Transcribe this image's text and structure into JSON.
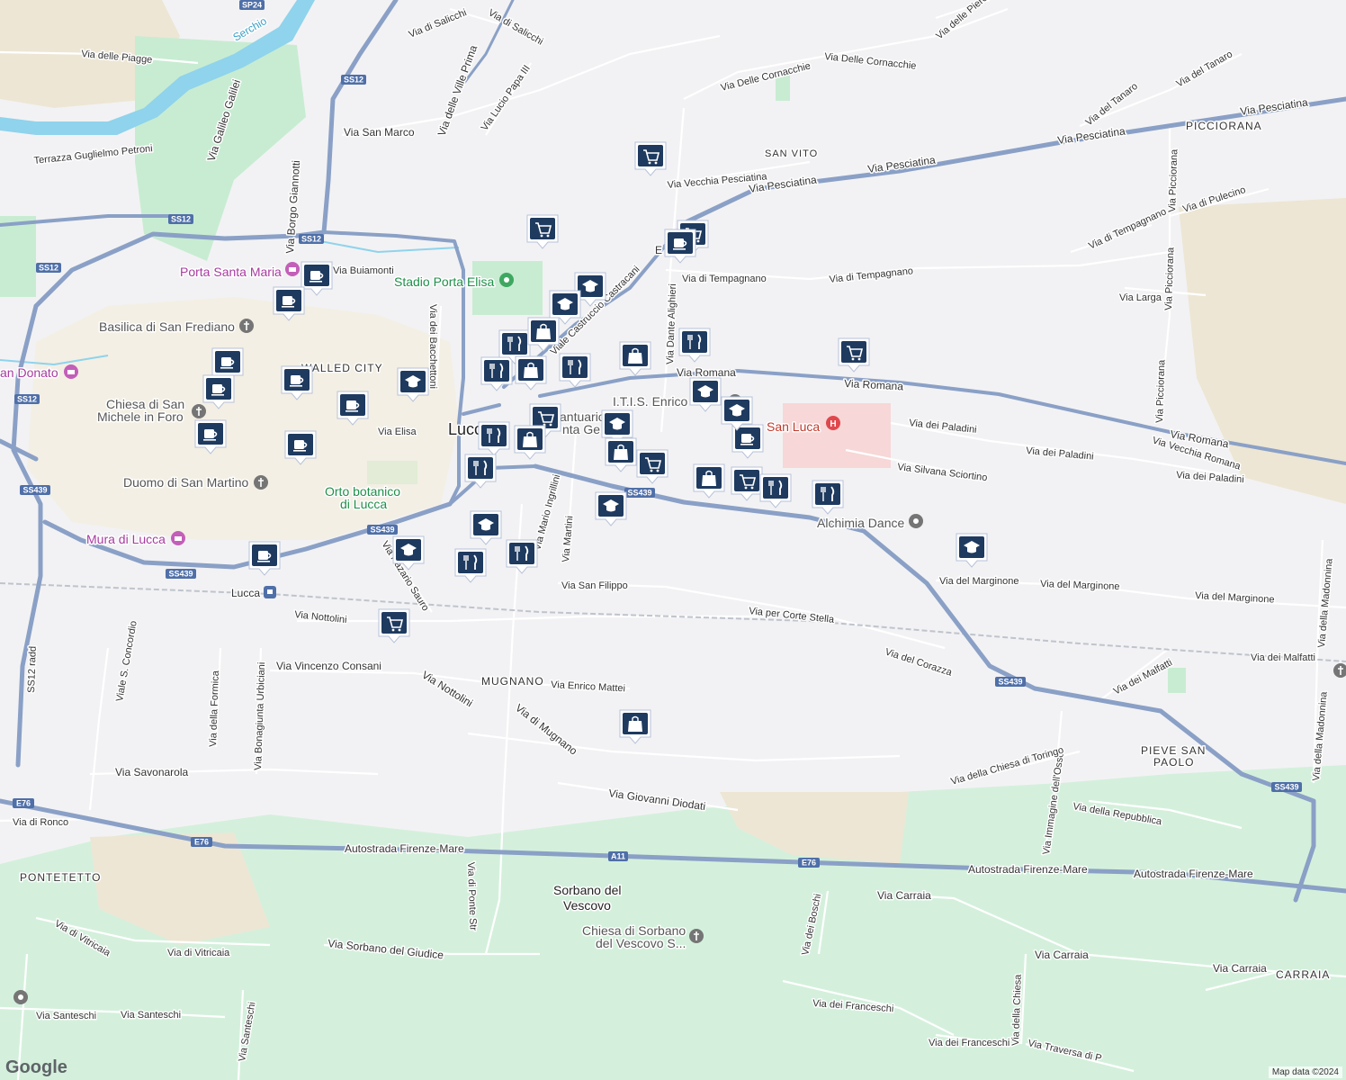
{
  "map": {
    "attribution": "Map data ©2024",
    "logo_text": "Google",
    "colors": {
      "background": "#f2f2f4",
      "park": "#c8ecd2",
      "road_major": "#8aa0c6",
      "road_minor": "#ffffff",
      "water": "#8fd3ec",
      "marker": "#1e3a5f"
    },
    "labels": {
      "lucca": "Lucca",
      "lucca_station": "Lucca",
      "walled_city": "WALLED CITY",
      "san_vito": "SAN VITO",
      "picciorana": "PICCIORANA",
      "mugnano": "MUGNANO",
      "pieve_san_paolo_1": "PIEVE SAN",
      "pieve_san_paolo_2": "PAOLO",
      "pontetetto": "PONTETETTO",
      "sorbano_1": "Sorbano del",
      "sorbano_2": "Vescovo",
      "carraia": "CARRAIA",
      "serchio": "Serchio",
      "porta_santa_maria": "Porta Santa Maria",
      "stadio": "Stadio Porta Elisa",
      "basilica": "Basilica di San Frediano",
      "san_donato": "an Donato",
      "chiesa_michele_1": "Chiesa di San",
      "chiesa_michele_2": "Michele in Foro",
      "duomo": "Duomo di San Martino",
      "orto_1": "Orto botanico",
      "orto_2": "di Lucca",
      "mura": "Mura di Lucca",
      "itis": "I.T.I.S. Enrico",
      "santuario_1": "antuario",
      "santuario_2": "nta Ge",
      "ospedale": "O",
      "ospedale_2": "San Luca",
      "alchimia": "Alchimia Dance",
      "chiesa_sorbano_1": "Chiesa di Sorbano",
      "chiesa_sorbano_2": "del Vescovo S...",
      "e_label": "E"
    },
    "roads": {
      "via_pesciatina": "Via Pesciatina",
      "via_romana": "Via Romana",
      "via_di_tempagnano": "Via di Tempagnano",
      "via_delle_cornacchie": "Via Delle Cornacchie",
      "via_vecchia_pesciatina": "Via Vecchia Pesciatina",
      "via_san_marco": "Via San Marco",
      "via_elisa": "Via Elisa",
      "via_buiamonti": "Via Buiamonti",
      "via_dei_bacchettoni": "Via dei Bacchettoni",
      "via_dei_paladini": "Via dei Paladini",
      "via_silvana_sciortino": "Via Silvana Sciortino",
      "via_del_marginone": "Via del Marginone",
      "via_san_filippo": "Via San Filippo",
      "via_per_corte_stella": "Via per Corte Stella",
      "via_del_corazza": "Via del Corazza",
      "via_dei_malfatti": "Via dei Malfatti",
      "via_nottolini": "Via Nottolini",
      "via_vincenzo_consani": "Via Vincenzo Consani",
      "via_enrico_mattei": "Via Enrico Mattei",
      "via_di_mugnano": "Via di Mugnano",
      "via_giovanni_diodati": "Via Giovanni Diodati",
      "via_savonarola": "Via Savonarola",
      "via_di_ronco": "Via di Ronco",
      "autostrada": "Autostrada Firenze-Mare",
      "via_carraia": "Via Carraia",
      "via_sorbano_giudice": "Via Sorbano del Giudice",
      "via_di_vitricaia": "Via di Vitricaia",
      "via_santeschi": "Via Santeschi",
      "via_dei_franceschi": "Via dei Franceschi",
      "via_di_ponte_str": "Via di Ponte Str",
      "via_dei_boschi": "Via dei Boschi",
      "via_della_chiesa": "Via della Chiesa",
      "via_della_repubblica": "Via della Repubblica",
      "via_immagine_osso": "Via Immagine dell'Osso",
      "via_chiesa_toringo": "Via della Chiesa di Toringo",
      "via_della_madonnina": "Via della Madonnina",
      "via_picciorana": "Via Picciorana",
      "via_larga": "Via Larga",
      "via_di_pulecino": "Via di Pulecino",
      "via_del_tanaro": "Via del Tanaro",
      "via_delle_piagge": "Via delle Piagge",
      "terrazza_petroni": "Terrazza Guglielmo Petroni",
      "via_galileo_galilei": "Via Galileo Galilei",
      "via_borgo_giannotti": "Via Borgo Giannotti",
      "via_delle_ville_prima": "Via delle Ville Prima",
      "via_lucio_papa": "Via Lucio Papa III",
      "via_di_salicchi": "Via di Salicchi",
      "via_castracani": "Viale Castruccio Castracani",
      "via_dante_alighieri": "Via Dante Alighieri",
      "via_della_formica": "Via della Formica",
      "via_bonagiunta": "Via Bonagiunta Urbiciani",
      "viale_concordio": "Viale S. Concordio",
      "via_martini": "Via Martini",
      "via_nazario_sauro": "Via Nazario Sauro",
      "via_ingrillini": "Via Mario Ingrillini",
      "via_della_formica_2": "Via della Formica",
      "via_santeschi_2": "Via Santeschi",
      "via_traversa": "Via Traversa di P",
      "via_delle_piero": "Via delle Piero"
    },
    "shields": [
      "SP24",
      "SS12",
      "SS12",
      "SS12",
      "SS12",
      "SS12",
      "SS439",
      "SS439",
      "SS439",
      "SS439",
      "SS439",
      "SS439",
      "E76",
      "E76",
      "E76",
      "A11"
    ],
    "markers": [
      {
        "icon": "cart-icon"
      },
      {
        "icon": "cart-icon"
      },
      {
        "icon": "cart-icon"
      },
      {
        "icon": "cart-icon"
      },
      {
        "icon": "cart-icon"
      },
      {
        "icon": "cart-icon"
      },
      {
        "icon": "cart-icon"
      },
      {
        "icon": "cart-icon"
      },
      {
        "icon": "cup-icon"
      },
      {
        "icon": "cup-icon"
      },
      {
        "icon": "cup-icon"
      },
      {
        "icon": "cup-icon"
      },
      {
        "icon": "cup-icon"
      },
      {
        "icon": "cup-icon"
      },
      {
        "icon": "cup-icon"
      },
      {
        "icon": "cup-icon"
      },
      {
        "icon": "cup-icon"
      },
      {
        "icon": "cup-icon"
      },
      {
        "icon": "cup-icon"
      },
      {
        "icon": "school-icon"
      },
      {
        "icon": "school-icon"
      },
      {
        "icon": "school-icon"
      },
      {
        "icon": "school-icon"
      },
      {
        "icon": "school-icon"
      },
      {
        "icon": "school-icon"
      },
      {
        "icon": "school-icon"
      },
      {
        "icon": "school-icon"
      },
      {
        "icon": "school-icon"
      },
      {
        "icon": "school-icon"
      },
      {
        "icon": "fork-knife-icon"
      },
      {
        "icon": "fork-knife-icon"
      },
      {
        "icon": "fork-knife-icon"
      },
      {
        "icon": "fork-knife-icon"
      },
      {
        "icon": "fork-knife-icon"
      },
      {
        "icon": "fork-knife-icon"
      },
      {
        "icon": "fork-knife-icon"
      },
      {
        "icon": "fork-knife-icon"
      },
      {
        "icon": "fork-knife-icon"
      },
      {
        "icon": "fork-knife-icon"
      },
      {
        "icon": "bag-icon"
      },
      {
        "icon": "bag-icon"
      },
      {
        "icon": "bag-icon"
      },
      {
        "icon": "bag-icon"
      },
      {
        "icon": "bag-icon"
      },
      {
        "icon": "bag-icon"
      },
      {
        "icon": "bag-icon"
      }
    ]
  }
}
